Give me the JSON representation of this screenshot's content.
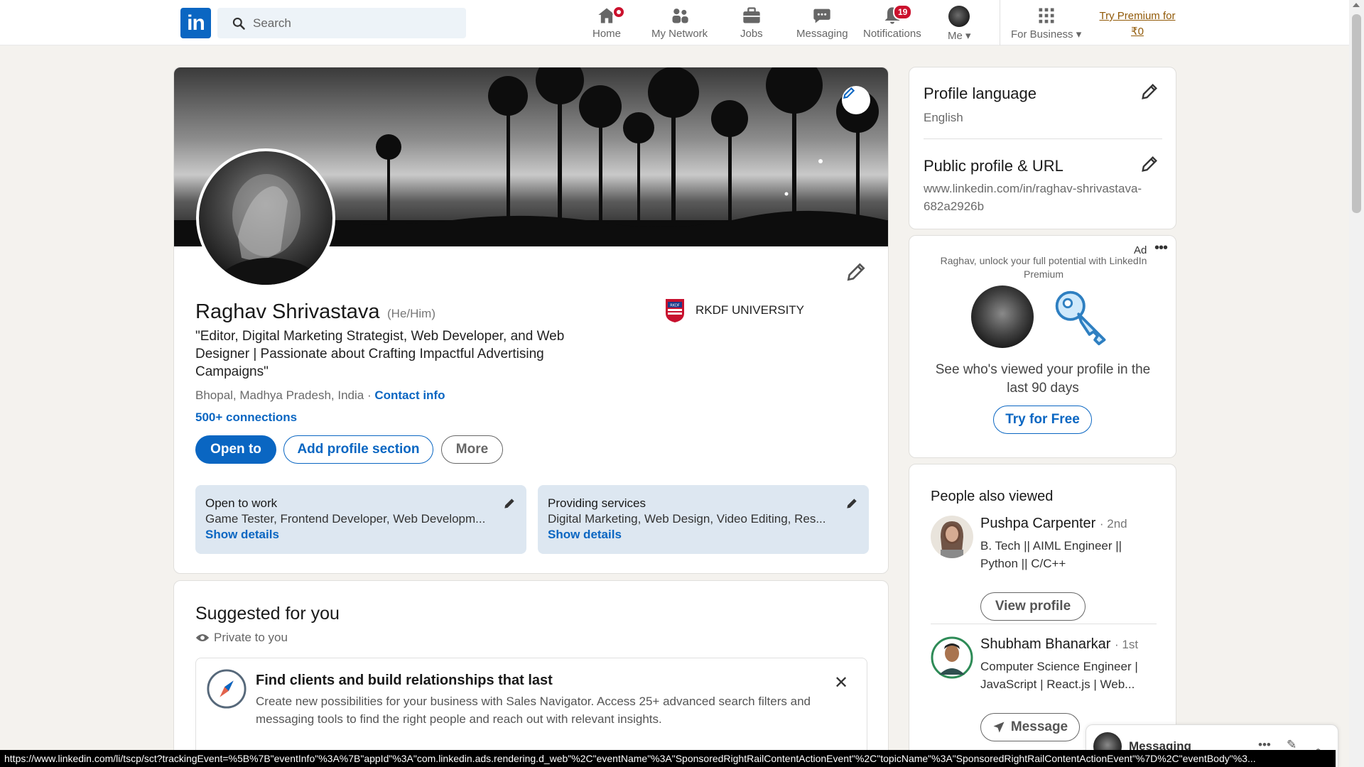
{
  "nav": {
    "logo": "in",
    "search_placeholder": "Search",
    "items": [
      {
        "label": "Home",
        "icon": "home-icon"
      },
      {
        "label": "My Network",
        "icon": "network-icon"
      },
      {
        "label": "Jobs",
        "icon": "jobs-icon"
      },
      {
        "label": "Messaging",
        "icon": "messaging-icon"
      },
      {
        "label": "Notifications",
        "icon": "bell-icon",
        "badge": "19"
      },
      {
        "label": "Me",
        "icon": "avatar"
      },
      {
        "label": "For Business",
        "icon": "grid-icon"
      }
    ],
    "premium": "Try Premium for ₹0"
  },
  "profile": {
    "name": "Raghav Shrivastava",
    "pronouns": "(He/Him)",
    "headline": "\"Editor, Digital Marketing Strategist, Web Developer, and Web Designer | Passionate about Crafting Impactful Advertising Campaigns\"",
    "location": "Bhopal, Madhya Pradesh, India",
    "location_sep": " · ",
    "contact_info": "Contact info",
    "connections": "500+ connections",
    "education": "RKDF UNIVERSITY",
    "buttons": {
      "open_to": "Open to",
      "add_section": "Add profile section",
      "more": "More"
    },
    "open_to_work": {
      "title": "Open to work",
      "detail": "Game Tester, Frontend Developer, Web Developm...",
      "link": "Show details"
    },
    "providing_services": {
      "title": "Providing services",
      "detail": "Digital Marketing, Web Design, Video Editing, Res...",
      "link": "Show details"
    }
  },
  "suggested": {
    "title": "Suggested for you",
    "private": "Private to you",
    "card_title": "Find clients and build relationships that last",
    "card_desc": "Create new possibilities for your business with Sales Navigator. Access 25+ advanced search filters and messaging tools to find the right people and reach out with relevant insights."
  },
  "right": {
    "lang_title": "Profile language",
    "lang_value": "English",
    "url_title": "Public profile & URL",
    "url_value": "www.linkedin.com/in/raghav-shrivastava-682a2926b",
    "ad_tag": "Ad",
    "ad_line": "Raghav, unlock your full potential with LinkedIn Premium",
    "ad_text": "See who's viewed your profile in the last 90 days",
    "ad_button": "Try for Free",
    "pav_title": "People also viewed",
    "people": [
      {
        "name": "Pushpa Carpenter",
        "degree": "· 2nd",
        "headline": "B. Tech || AIML Engineer || Python || C/C++",
        "button": "View profile"
      },
      {
        "name": "Shubham Bhanarkar",
        "degree": "· 1st",
        "headline": "Computer Science Engineer | JavaScript | React.js | Web...",
        "button": "Message"
      }
    ]
  },
  "messaging_tab": {
    "label": "Messaging"
  },
  "status_url": "https://www.linkedin.com/li/tscp/sct?trackingEvent=%5B%7B\"eventInfo\"%3A%7B\"appId\"%3A\"com.linkedin.ads.rendering.d_web\"%2C\"eventName\"%3A\"SponsoredRightRailContentActionEvent\"%2C\"topicName\"%3A\"SponsoredRightRailContentActionEvent\"%7D%2C\"eventBody\"%3..."
}
